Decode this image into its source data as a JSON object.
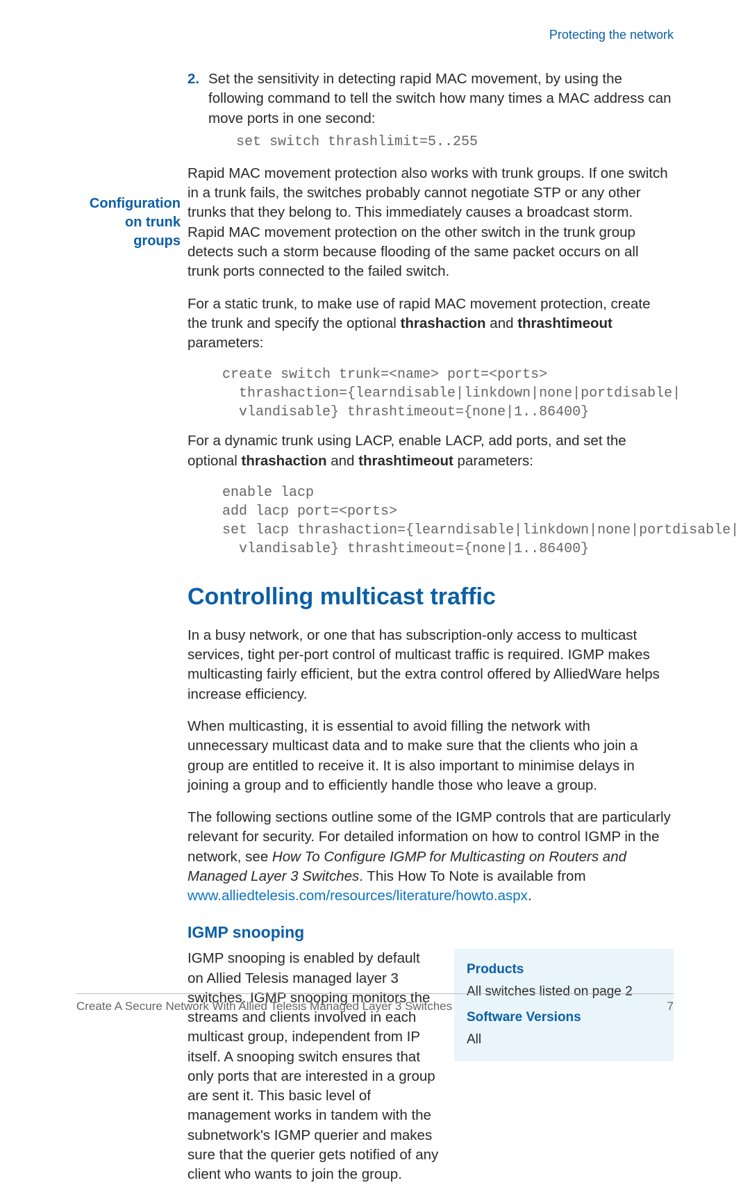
{
  "header": {
    "right": "Protecting the network"
  },
  "step2": {
    "num": "2.",
    "text": "Set the sensitivity in detecting rapid MAC movement, by using the following command to tell the switch how many times a MAC address can move ports in one second:",
    "code": "set switch thrashlimit=5..255"
  },
  "sidelabel": "Configuration\non trunk\ngroups",
  "config_para1": "Rapid MAC movement protection also works with trunk groups. If one switch in a trunk fails, the switches probably cannot negotiate STP or any other trunks that they belong to. This immediately causes a broadcast storm. Rapid MAC movement protection on the other switch in the trunk group detects such a storm because flooding of the same packet occurs on all trunk ports connected to the failed switch.",
  "config_para2_pre": "For a static trunk, to make use of rapid MAC movement protection, create the trunk and specify the optional ",
  "bold_thrashaction": "thrashaction",
  "and_word": " and ",
  "bold_thrashtimeout": "thrashtimeout",
  "params_suffix": " parameters:",
  "code_static": "create switch trunk=<name> port=<ports>\n  thrashaction={learndisable|linkdown|none|portdisable|\n  vlandisable} thrashtimeout={none|1..86400}",
  "config_para3_pre": "For a dynamic trunk using LACP, enable LACP, add ports, and set the optional ",
  "code_dynamic": "enable lacp\nadd lacp port=<ports>\nset lacp thrashaction={learndisable|linkdown|none|portdisable|\n  vlandisable} thrashtimeout={none|1..86400}",
  "h2": "Controlling multicast traffic",
  "mc_para1": "In a busy network, or one that has subscription-only access to multicast services, tight per-port control of multicast traffic is required. IGMP makes multicasting fairly efficient, but the extra control offered by AlliedWare helps increase efficiency.",
  "mc_para2": "When multicasting, it is essential to avoid filling the network with unnecessary multicast data and to make sure that the clients who join a group are entitled to receive it. It is also important to minimise delays in joining a group and to efficiently handle those who leave a group.",
  "mc_para3_a": "The following sections outline some of the IGMP controls that are particularly relevant for security. For detailed information on how to control IGMP in the network, see ",
  "mc_para3_i": "How To Configure IGMP for Multicasting on Routers and Managed Layer 3 Switches",
  "mc_para3_b": ". This How To Note is available from ",
  "mc_para3_link": "www.alliedtelesis.com/resources/literature/howto.aspx",
  "mc_para3_c": ".",
  "h3": "IGMP snooping",
  "snoop_para": "IGMP snooping is enabled by default on Allied Telesis managed layer 3 switches. IGMP snooping monitors the streams and clients involved in each multicast group, independent from IP itself. A snooping switch ensures that only ports that are interested in a group are sent it. This basic level of management works in tandem with the subnetwork's IGMP querier and makes sure that the querier gets notified of any client who wants to join the group.",
  "infobox": {
    "products_hd": "Products",
    "products_body": "All switches listed on page 2",
    "versions_hd": "Software Versions",
    "versions_body": "All"
  },
  "footer": {
    "left": "Create A Secure Network With Allied Telesis Managed Layer 3 Switches",
    "right": "7"
  }
}
